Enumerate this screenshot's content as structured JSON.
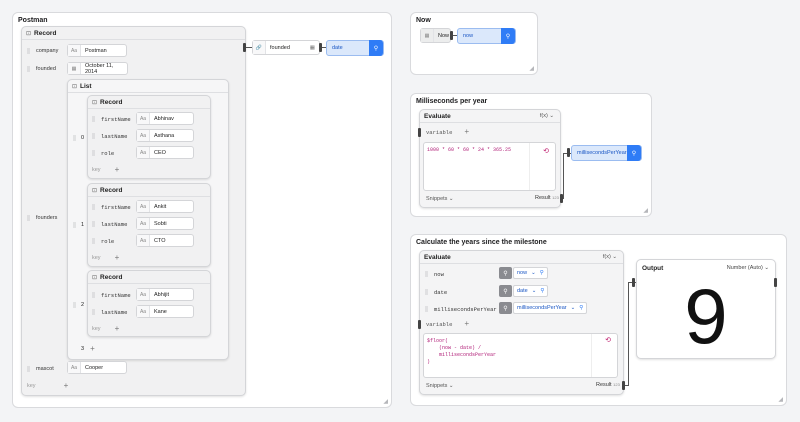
{
  "postman": {
    "title": "Postman",
    "record_header": "Record",
    "company": {
      "key": "company",
      "value": "Postman",
      "type_icon": "Aa"
    },
    "founded": {
      "key": "founded",
      "value": "October 11, 2014"
    },
    "founders_key": "founders",
    "list_header": "List",
    "founders": [
      {
        "index": "0",
        "record_header": "Record",
        "firstName": "Abhinav",
        "lastName": "Asthana",
        "role": "CEO"
      },
      {
        "index": "1",
        "record_header": "Record",
        "firstName": "Ankit",
        "lastName": "Sobti",
        "role": "CTO"
      },
      {
        "index": "2",
        "record_header": "Record",
        "firstName": "Abhijit",
        "lastName": "Kane"
      }
    ],
    "field_labels": {
      "firstName": "firstName",
      "lastName": "lastName",
      "role": "role"
    },
    "key_placeholder": "key",
    "list_next_index": "3",
    "mascot": {
      "key": "mascot",
      "value": "Cooper"
    },
    "outer_key_placeholder": "key",
    "founded_node": {
      "label": "founded"
    },
    "date_var": {
      "label": "date"
    }
  },
  "now_frame": {
    "title": "Now",
    "button_label": "Now",
    "var_label": "now"
  },
  "ms_frame": {
    "title": "Milliseconds per year",
    "eval_header": "Evaluate",
    "fx_label": "f(x)",
    "variable_label": "variable",
    "code": "1000 * 60 * 60 * 24 * 365.25",
    "snippets_label": "Snippets",
    "result_label": "Result",
    "result_num": "123",
    "var_label": "millisecondsPerYear"
  },
  "years_frame": {
    "title": "Calculate the years since the milestone",
    "eval_header": "Evaluate",
    "fx_label": "f(x)",
    "inputs": [
      {
        "key": "now",
        "value": "now"
      },
      {
        "key": "date",
        "value": "date"
      },
      {
        "key": "millisecondsPerYear",
        "value": "millisecondsPerYear"
      }
    ],
    "variable_label": "variable",
    "code_lines": [
      "$floor(",
      "    (now - date) /",
      "    millisecondsPerYear",
      ")"
    ],
    "snippets_label": "Snippets",
    "result_label": "Result",
    "result_num": "123",
    "output_header": "Output",
    "output_format": "Number (Auto)",
    "output_value": "9"
  },
  "colors": {
    "accent": "#2f7cf6",
    "code": "#b2227a"
  }
}
